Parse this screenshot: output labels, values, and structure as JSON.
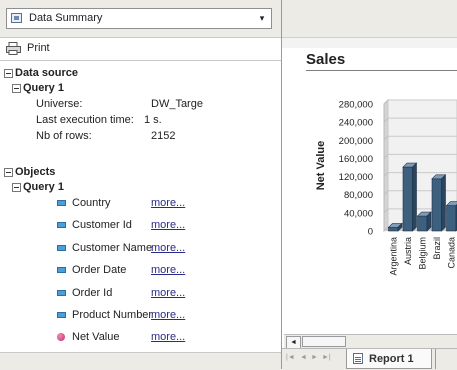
{
  "left_panel": {
    "selector": {
      "value": "Data Summary",
      "icon": "table-icon",
      "caret": "▾"
    },
    "print": {
      "label": "Print",
      "icon": "printer-icon"
    },
    "data_source": {
      "section_label": "Data source",
      "query_label": "Query 1",
      "rows": [
        {
          "label": "Universe:",
          "value": "DW_Targe"
        },
        {
          "label": "Last execution time:",
          "value": "1 s."
        },
        {
          "label": "Nb of rows:",
          "value": "2152"
        }
      ]
    },
    "objects": {
      "section_label": "Objects",
      "query_label": "Query 1",
      "items": [
        {
          "name": "Country",
          "more": "more...",
          "kind": "dimension"
        },
        {
          "name": "Customer Id",
          "more": "more...",
          "kind": "dimension"
        },
        {
          "name": "Customer Name",
          "more": "more...",
          "kind": "dimension"
        },
        {
          "name": "Order Date",
          "more": "more...",
          "kind": "dimension"
        },
        {
          "name": "Order Id",
          "more": "more...",
          "kind": "dimension"
        },
        {
          "name": "Product Number",
          "more": "more...",
          "kind": "dimension"
        },
        {
          "name": "Net Value",
          "more": "more...",
          "kind": "measure"
        }
      ]
    }
  },
  "report": {
    "title": "Sales",
    "tab_label": "Report 1",
    "scroll_arrow": "◄",
    "nav_buttons": [
      "|◄",
      "◄",
      "►",
      "►|"
    ]
  },
  "chart_data": {
    "type": "bar",
    "title": "",
    "xlabel": "",
    "ylabel": "Net Value",
    "ylim": [
      0,
      280000
    ],
    "ytick_labels": [
      "0",
      "40,000",
      "80,000",
      "120,000",
      "160,000",
      "200,000",
      "240,000",
      "280,000"
    ],
    "categories": [
      "Argentina",
      "Austria",
      "Belgium",
      "Brazil",
      "Canada"
    ],
    "values": [
      8000,
      141000,
      33000,
      115000,
      56000
    ],
    "bar_color": "#3d607f",
    "grid": true
  },
  "colors": {
    "link": "#2a2a8a",
    "dimension_icon": "#4b9ed9",
    "measure_icon": "#c0306e",
    "toolbar_bg": "#ecebe6"
  }
}
